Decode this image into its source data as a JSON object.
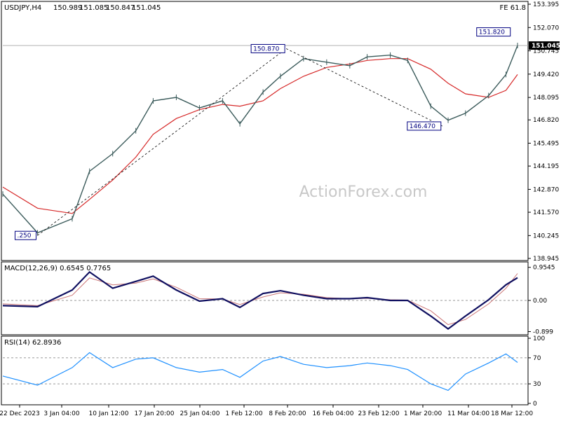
{
  "chart_data": {
    "type": "line",
    "symbol": "USDJPY,H4",
    "ohlc_header": {
      "open": "150.989",
      "high": "151.085",
      "low": "150.847",
      "close": "151.045"
    },
    "fe_label": "FE 61.8",
    "watermark": "ActionForex.com",
    "price_axis": {
      "ticks": [
        "153.395",
        "152.070",
        "150.745",
        "149.420",
        "148.095",
        "146.820",
        "145.495",
        "144.195",
        "142.870",
        "141.570",
        "140.245",
        "138.945"
      ],
      "ylim": [
        138.945,
        153.395
      ],
      "current_price": "151.045"
    },
    "annotations": [
      {
        "text": "150.870",
        "date": "9 Feb 2024",
        "value": 150.87
      },
      {
        "text": "151.820",
        "date": "19 Mar 2024",
        "value": 151.82
      },
      {
        "text": "146.470",
        "date": "7 Mar 2024",
        "value": 146.47
      },
      {
        "text": ".250",
        "date": "28 Dec 2023",
        "value": 140.25
      }
    ],
    "x_axis": {
      "labels": [
        "22 Dec 2023",
        "3 Jan 04:00",
        "10 Jan 12:00",
        "17 Jan 20:00",
        "25 Jan 04:00",
        "1 Feb 12:00",
        "8 Feb 20:00",
        "16 Feb 04:00",
        "23 Feb 12:00",
        "1 Mar 20:00",
        "11 Mar 04:00",
        "18 Mar 12:00"
      ]
    },
    "price_series": {
      "name": "USDJPY",
      "dates": [
        "22 Dec 2023",
        "28 Dec 2023",
        "3 Jan 2024",
        "6 Jan 2024",
        "10 Jan 2024",
        "14 Jan 2024",
        "17 Jan 2024",
        "21 Jan 2024",
        "25 Jan 2024",
        "29 Jan 2024",
        "1 Feb 2024",
        "5 Feb 2024",
        "8 Feb 2024",
        "12 Feb 2024",
        "16 Feb 2024",
        "20 Feb 2024",
        "23 Feb 2024",
        "27 Feb 2024",
        "1 Mar 2024",
        "5 Mar 2024",
        "8 Mar 2024",
        "11 Mar 2024",
        "15 Mar 2024",
        "18 Mar 2024",
        "20 Mar 2024"
      ],
      "values": [
        142.6,
        140.4,
        141.2,
        143.9,
        144.9,
        146.2,
        147.9,
        148.1,
        147.5,
        147.9,
        146.6,
        148.4,
        149.3,
        150.3,
        150.1,
        149.9,
        150.4,
        150.5,
        150.2,
        147.6,
        146.8,
        147.2,
        148.2,
        149.4,
        151.045
      ]
    },
    "sma_series": {
      "name": "SMA",
      "values": [
        143.0,
        141.8,
        141.5,
        142.3,
        143.4,
        144.7,
        146.0,
        146.9,
        147.4,
        147.7,
        147.6,
        147.9,
        148.6,
        149.3,
        149.8,
        150.0,
        150.2,
        150.3,
        150.3,
        149.7,
        148.9,
        148.3,
        148.1,
        148.5,
        149.4
      ]
    },
    "macd": {
      "title": "MACD(12,26,9) 0.6545 0.7765",
      "ticks": [
        "0.9545",
        "0.00",
        "-0.899"
      ],
      "ylim": [
        -0.95,
        1.05
      ],
      "values": [
        -0.15,
        -0.18,
        0.3,
        0.82,
        0.35,
        0.55,
        0.7,
        0.3,
        -0.02,
        0.05,
        -0.2,
        0.2,
        0.28,
        0.15,
        0.05,
        0.05,
        0.08,
        0.0,
        0.0,
        -0.45,
        -0.82,
        -0.45,
        0.02,
        0.45,
        0.6545
      ],
      "signal": [
        -0.1,
        -0.15,
        0.15,
        0.65,
        0.45,
        0.5,
        0.62,
        0.38,
        0.05,
        0.04,
        -0.12,
        0.1,
        0.22,
        0.18,
        0.08,
        0.05,
        0.06,
        0.02,
        0.01,
        -0.3,
        -0.7,
        -0.55,
        -0.1,
        0.35,
        0.7765
      ]
    },
    "rsi": {
      "title": "RSI(14) 62.8936",
      "ticks": [
        "100",
        "70",
        "30",
        "0"
      ],
      "ylim": [
        0,
        100
      ],
      "values": [
        42,
        28,
        55,
        78,
        55,
        68,
        70,
        55,
        48,
        52,
        40,
        65,
        72,
        60,
        55,
        58,
        62,
        58,
        52,
        30,
        20,
        45,
        62,
        76,
        62.8936
      ]
    }
  }
}
